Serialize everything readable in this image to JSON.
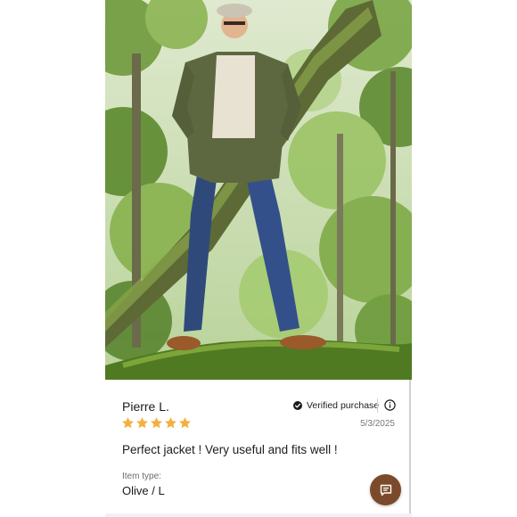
{
  "review": {
    "reviewer_name": "Pierre L.",
    "verified_label": "Verified purchase",
    "rating": 5,
    "rating_max": 5,
    "date": "5/3/2025",
    "text": "Perfect jacket ! Very useful and fits well !",
    "item_type_label": "Item type:",
    "item_type_value": "Olive / L"
  },
  "icons": {
    "verified": "check-circle-icon",
    "info": "info-icon",
    "star": "star-icon",
    "chat": "chat-icon"
  },
  "colors": {
    "star": "#f4b03e",
    "chat_button": "#7a4a2a",
    "text": "#1c1c1c",
    "muted": "#7a7a7a"
  }
}
